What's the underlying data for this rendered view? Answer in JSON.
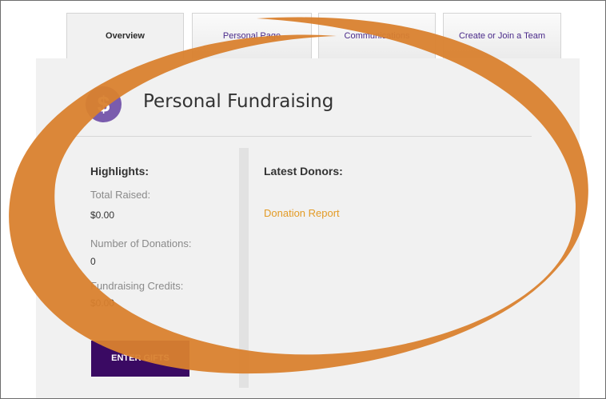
{
  "tabs": [
    {
      "label": "Overview",
      "active": true
    },
    {
      "label": "Personal Page",
      "active": false
    },
    {
      "label": "Communications",
      "active": false
    },
    {
      "label": "Create or Join a Team",
      "active": false
    }
  ],
  "header": {
    "badge_symbol": "$",
    "badge_icon": "dollar-icon",
    "title": "Personal Fundraising"
  },
  "highlights": {
    "title": "Highlights:",
    "items": [
      {
        "label": "Total Raised:",
        "value": "$0.00"
      },
      {
        "label": "Number of Donations:",
        "value": "0"
      },
      {
        "label": "Fundraising Credits:",
        "value": "$0.00"
      }
    ]
  },
  "donors": {
    "title": "Latest Donors:",
    "report_link": "Donation Report"
  },
  "actions": {
    "enter_gifts_label": "ENTER GIFTS"
  },
  "colors": {
    "accent_purple": "#7a5cad",
    "button_purple": "#3a0a63",
    "link_orange": "#e39b26",
    "annotation_orange": "#d9812e"
  }
}
